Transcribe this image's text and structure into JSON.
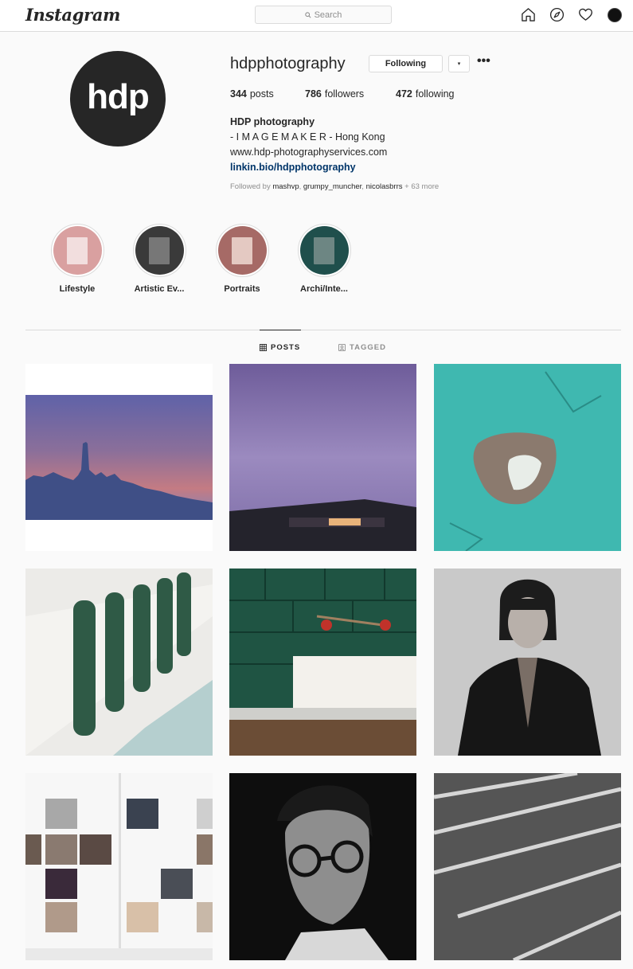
{
  "nav": {
    "logo": "Instagram",
    "search_placeholder": "Search",
    "icons": [
      "home-icon",
      "explore-compass-icon",
      "heart-icon",
      "profile-avatar-icon"
    ]
  },
  "profile": {
    "avatar_text": "hdp",
    "username": "hdpphotography",
    "following_button": "Following",
    "dropdown_glyph": "▾",
    "more_glyph": "•••",
    "stats": {
      "posts_count": "344",
      "posts_label": "posts",
      "followers_count": "786",
      "followers_label": "followers",
      "following_count": "472",
      "following_label": "following"
    },
    "bio": {
      "name": "HDP photography",
      "line1": "- I M A G E M A K E R - Hong Kong",
      "line2": "www.hdp-photographyservices.com",
      "link": "linkin.bio/hdpphotography"
    },
    "followed_by": {
      "prefix": "Followed by",
      "user1": "mashvp",
      "user2": "grumpy_muncher",
      "user3": "nicolasbrrs",
      "more": "+ 63 more"
    }
  },
  "highlights": [
    {
      "label": "Lifestyle",
      "bg": "#d9a0a0"
    },
    {
      "label": "Artistic Ev...",
      "bg": "#3a3a3a"
    },
    {
      "label": "Portraits",
      "bg": "#a66a66"
    },
    {
      "label": "Archi/Inte...",
      "bg": "#1f4f4c"
    }
  ],
  "tabs": {
    "posts": "POSTS",
    "tagged": "TAGGED"
  },
  "colors": {
    "link": "#003569",
    "border": "#dbdbdb",
    "muted": "#8e8e8e",
    "text": "#262626"
  }
}
